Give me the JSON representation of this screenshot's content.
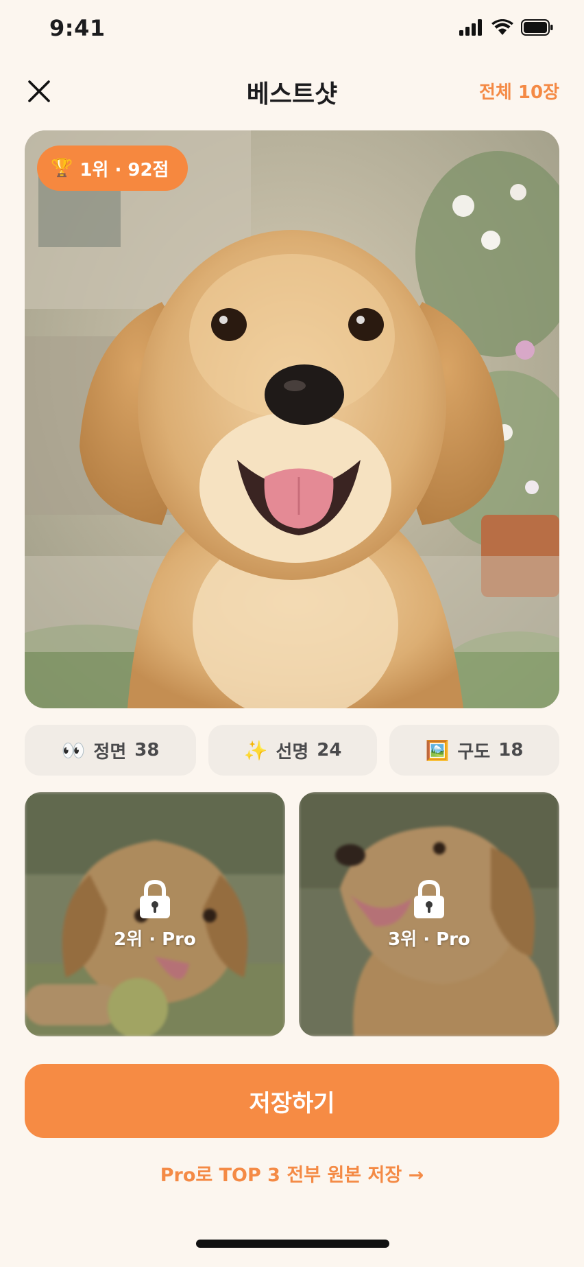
{
  "status_bar": {
    "time": "9:41"
  },
  "header": {
    "title": "베스트샷",
    "total": "전체 10장"
  },
  "hero": {
    "badge_icon": "🏆",
    "badge_text": "1위 · 92점"
  },
  "metrics": [
    {
      "icon": "👀",
      "label": "정면",
      "value": "38"
    },
    {
      "icon": "✨",
      "label": "선명",
      "value": "24"
    },
    {
      "icon": "🖼️",
      "label": "구도",
      "value": "18"
    }
  ],
  "thumbnails": [
    {
      "label": "2위 · Pro"
    },
    {
      "label": "3위 · Pro"
    }
  ],
  "cta": {
    "save_label": "저장하기",
    "pro_link": "Pro로 TOP 3 전부 원본 저장 →"
  },
  "colors": {
    "accent": "#f68b44",
    "background": "#fcf6ef",
    "chip": "#f1ece6"
  }
}
